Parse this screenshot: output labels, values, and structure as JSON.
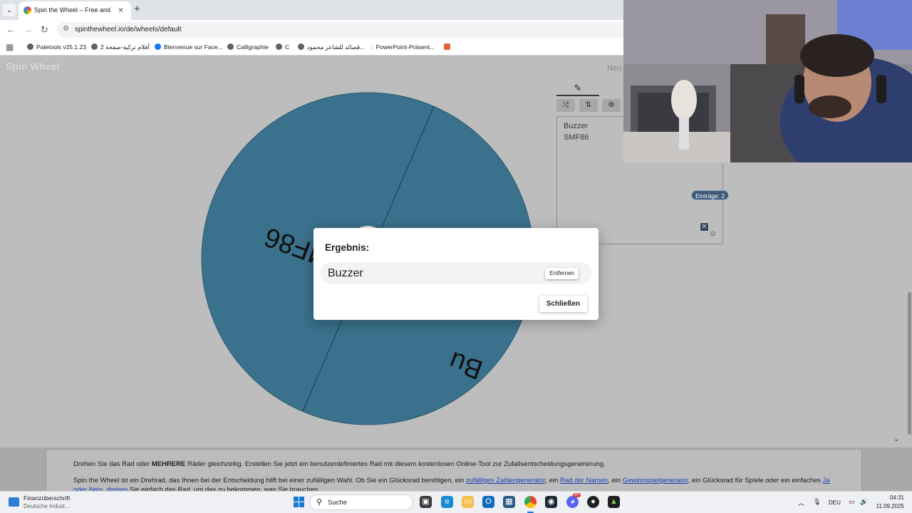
{
  "browser": {
    "tab_title": "Spin the Wheel – Free and easy",
    "url": "spinthewheel.io/de/wheels/default",
    "bookmarks": [
      {
        "label": "Paletools v25.1.23",
        "icon": "globe-icon"
      },
      {
        "label": "أفلام تركية-صفحة 2",
        "icon": "globe-icon"
      },
      {
        "label": "Bienvenue sur Face...",
        "icon": "facebook-icon"
      },
      {
        "label": "Calligraphie",
        "icon": "globe-icon"
      },
      {
        "label": "C",
        "icon": "globe-icon"
      },
      {
        "label": "قصائد للشاعر محمود...",
        "icon": "globe-icon"
      },
      {
        "label": "PowerPoint-Präsent...",
        "icon": "powerpoint-icon"
      }
    ]
  },
  "page": {
    "logo": "Spin Wheel",
    "new_link": "Neu",
    "wheel": {
      "color": "#3a718c",
      "segments": [
        "Buzzer",
        "SMF86"
      ],
      "visible_labels": [
        "SMF86",
        "Bu"
      ]
    },
    "editor": {
      "entries": [
        "Buzzer",
        "SMF86"
      ],
      "count_label": "Einträge: 2"
    }
  },
  "dialog": {
    "title": "Ergebnis:",
    "result": "Buzzer",
    "remove_label": "Entfernen",
    "close_label": "Schließen"
  },
  "info": {
    "p1_pre": "Drehen Sie das Rad oder ",
    "p1_bold": "MEHRERE",
    "p1_post": " Räder gleichzeitig. Erstellen Sie jetzt ein benutzerdefiniertes Rad mit diesem kostenlosen Online-Tool zur Zufallsentscheidungsgenerierung.",
    "p2_a": "Spin the Wheel ist ein Drehrad, das Ihnen bei der Entscheidung hilft bei einer zufälligen Wahl. Ob Sie ein Glücksrad benötigen, ein ",
    "p2_link1": "zufälliges Zahlengenerator",
    "p2_b": ", ein ",
    "p2_link2": "Rad der Namen",
    "p2_c": ", ein ",
    "p2_link3": "Gewinnspielgenerator",
    "p2_d": ", ein Glücksrad für Spiele oder ein einfaches ",
    "p2_link4": "Ja oder Nein, drehen",
    "p2_e": " Sie einfach das Rad, um das zu bekommen, was Sie brauchen."
  },
  "taskbar": {
    "weather_title": "Finanzüberschrift",
    "weather_sub": "Deutsche Indust...",
    "search_placeholder": "Suche",
    "lang": "DEU",
    "time": "04:31",
    "date": "11.09.2025",
    "discord_badge": "9+"
  },
  "colors": {
    "wheel": "#3a718c",
    "page_overlay": "#bdbdbd",
    "badge": "#3d5a78",
    "link": "#1a3fb5"
  }
}
